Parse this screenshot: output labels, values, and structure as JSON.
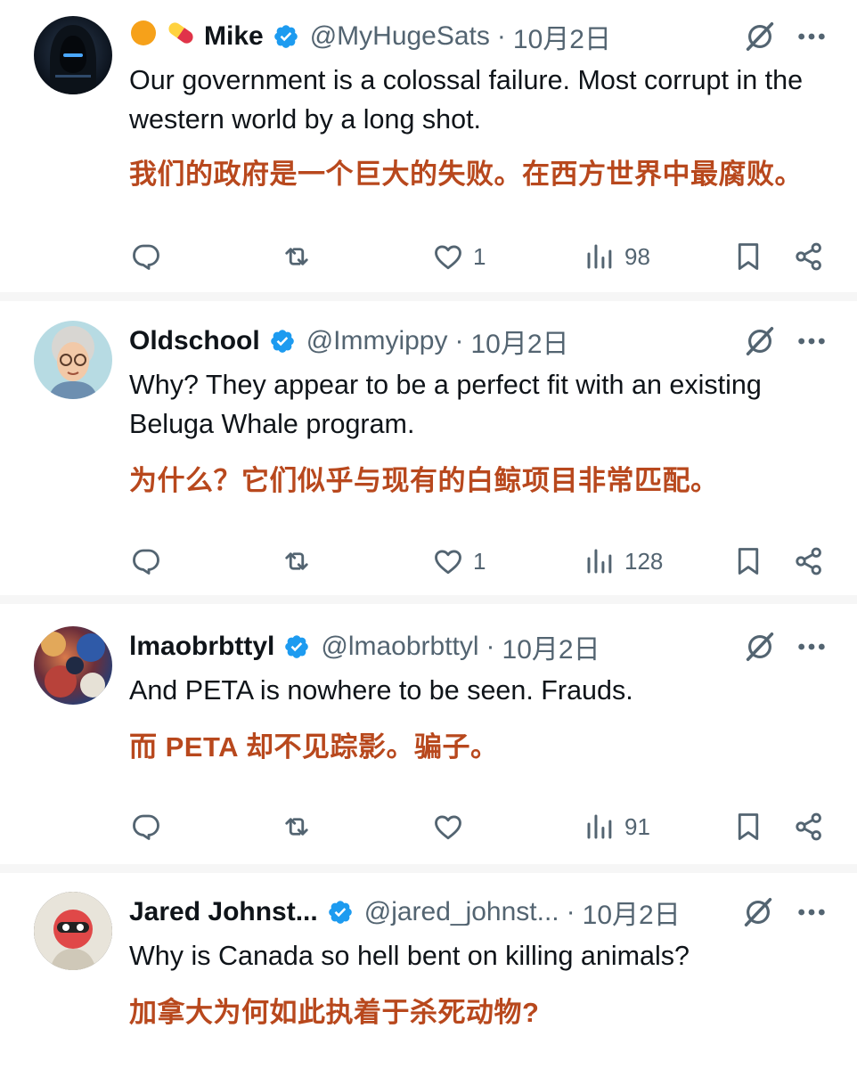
{
  "tweets": [
    {
      "name": "Mike",
      "handle": "@MyHugeSats",
      "date": "10月2日",
      "text_en": "Our government is a colossal failure. Most corrupt in the western world by a long shot.",
      "text_zh": "我们的政府是一个巨大的失败。在西方世界中最腐败。",
      "likes": "1",
      "views": "98"
    },
    {
      "name": "Oldschool",
      "handle": "@Immyippy",
      "date": "10月2日",
      "text_en": "Why? They appear to be a perfect fit with an existing Beluga Whale program.",
      "text_zh": "为什么？它们似乎与现有的白鲸项目非常匹配。",
      "likes": "1",
      "views": "128"
    },
    {
      "name": "lmaobrbttyl",
      "handle": "@lmaobrbttyl",
      "date": "10月2日",
      "text_en": "And PETA is nowhere to be seen. Frauds.",
      "text_zh": "而 PETA 却不见踪影。骗子。",
      "likes": "",
      "views": "91"
    },
    {
      "name": "Jared Johnst...",
      "handle": "@jared_johnst...",
      "date": "10月2日",
      "text_en": "Why is Canada so hell bent on killing animals?",
      "text_zh": "加拿大为何如此执着于杀死动物?"
    }
  ],
  "separator": "·",
  "icons": {
    "verified": "verified-badge-icon",
    "grok": "grok-icon",
    "more": "more-icon",
    "reply": "reply-icon",
    "retweet": "retweet-icon",
    "like": "heart-icon",
    "views": "views-icon",
    "bookmark": "bookmark-icon",
    "share": "share-icon"
  },
  "colors": {
    "verified": "#1d9bf0",
    "translation": "#b8481d",
    "secondary": "#536471"
  }
}
